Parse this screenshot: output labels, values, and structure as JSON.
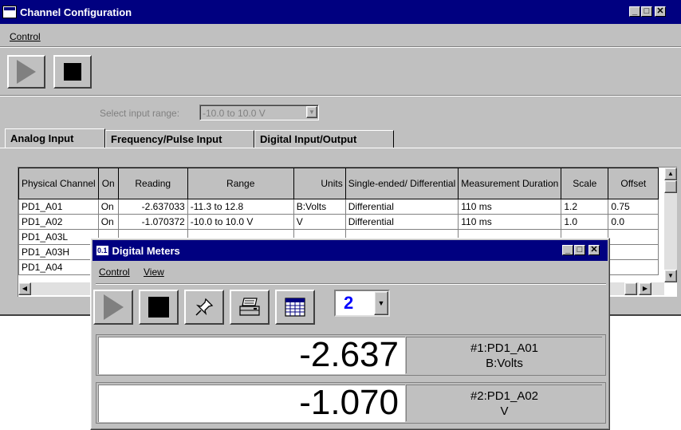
{
  "channel_window": {
    "title": "Channel Configuration",
    "menu": {
      "control": "Control"
    },
    "select_range_label": "Select input range:",
    "select_range_value": "-10.0 to 10.0 V",
    "tabs": [
      "Analog Input",
      "Frequency/Pulse Input",
      "Digital Input/Output"
    ],
    "table": {
      "headers": [
        "Physical Channel",
        "On",
        "Reading",
        "Range",
        "Units",
        "Single-ended/ Differential",
        "Measurement Duration",
        "Scale",
        "Offset"
      ],
      "rows": [
        [
          "PD1_A01",
          "On",
          "-2.637033",
          "-11.3 to 12.8",
          "B:Volts",
          "Differential",
          "110 ms",
          "1.2",
          "0.75"
        ],
        [
          "PD1_A02",
          "On",
          "-1.070372",
          "-10.0 to 10.0 V",
          "V",
          "Differential",
          "110 ms",
          "1.0",
          "0.0"
        ],
        [
          "PD1_A03L",
          "",
          "",
          "",
          "",
          "",
          "",
          "",
          ""
        ],
        [
          "PD1_A03H",
          "",
          "",
          "",
          "",
          "",
          "",
          "",
          ""
        ],
        [
          "PD1_A04",
          "",
          "",
          "",
          "",
          "",
          "",
          "",
          ""
        ]
      ]
    }
  },
  "meters_window": {
    "title": "Digital Meters",
    "icon_text": "0.1",
    "menu": {
      "control": "Control",
      "view": "View"
    },
    "meter_count": "2",
    "meters": [
      {
        "value": "-2.637",
        "label_line1": "#1:PD1_A01",
        "label_line2": "B:Volts"
      },
      {
        "value": "-1.070",
        "label_line1": "#2:PD1_A02",
        "label_line2": "V"
      }
    ]
  },
  "colors": {
    "title_bar": "#000080",
    "face": "#c0c0c0",
    "count_text": "#0000ff"
  }
}
